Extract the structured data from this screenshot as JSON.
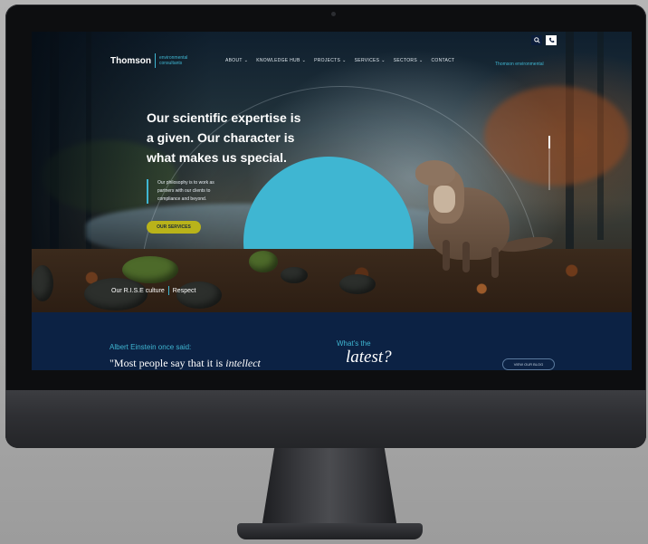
{
  "logo": {
    "name": "Thomson",
    "tagline": "environmental consultants"
  },
  "nav": {
    "items": [
      {
        "label": "ABOUT",
        "dropdown": true
      },
      {
        "label": "KNOWLEDGE HUB",
        "dropdown": true
      },
      {
        "label": "PROJECTS",
        "dropdown": true
      },
      {
        "label": "SERVICES",
        "dropdown": true
      },
      {
        "label": "SECTORS",
        "dropdown": true
      },
      {
        "label": "CONTACT",
        "dropdown": false
      }
    ],
    "search_icon": "search-icon",
    "phone_icon": "phone-icon",
    "chevron": "⌄",
    "header_link": "Thomson environmental"
  },
  "hero": {
    "headline_1": "Our scientific expertise is",
    "headline_2": "a given. Our character is",
    "headline_3": "what makes us special.",
    "sub_1": "Our philosophy is to work as",
    "sub_2": "partners with our clients to",
    "sub_3": "compliance and beyond.",
    "cta": "OUR SERVICES",
    "culture_a": "Our R.I.S.E culture",
    "culture_b": "Respect"
  },
  "quote": {
    "intro": "Albert Einstein once said:",
    "text_prefix": "\"Most people say that it is ",
    "text_italic": "intellect"
  },
  "latest": {
    "prefix": "What's the",
    "word": "latest?",
    "button": "VIEW OUR BLOG"
  },
  "colors": {
    "accent": "#3fb6d2",
    "navy": "#0c2244",
    "cta": "#b9b31a"
  }
}
